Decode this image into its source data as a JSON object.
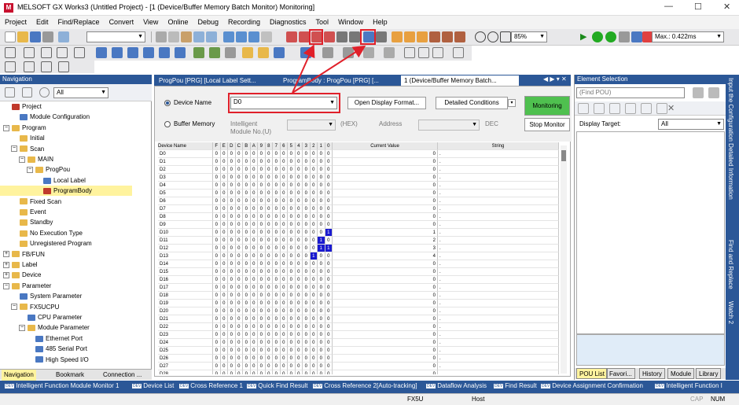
{
  "window": {
    "title": "MELSOFT GX Works3 (Untitled Project) - [1 (Device/Buffer Memory Batch Monitor) Monitoring]",
    "logo_text": "M",
    "minimize": "—",
    "maximize": "☐",
    "close": "✕"
  },
  "menu": [
    "Project",
    "Edit",
    "Find/Replace",
    "Convert",
    "View",
    "Online",
    "Debug",
    "Recording",
    "Diagnostics",
    "Tool",
    "Window",
    "Help"
  ],
  "toolbar": {
    "zoom": "85%",
    "scan_time": "Max.: 0.422ms"
  },
  "navigation": {
    "header": "Navigation",
    "filter": "All",
    "tree": [
      {
        "label": "Project",
        "depth": 0,
        "icon": "project",
        "expand": ""
      },
      {
        "label": "Module Configuration",
        "depth": 1,
        "icon": "module",
        "expand": ""
      },
      {
        "label": "Program",
        "depth": 0,
        "icon": "folder",
        "expand": "−"
      },
      {
        "label": "Initial",
        "depth": 1,
        "icon": "folder",
        "expand": ""
      },
      {
        "label": "Scan",
        "depth": 1,
        "icon": "folder",
        "expand": "−"
      },
      {
        "label": "MAIN",
        "depth": 2,
        "icon": "folder",
        "expand": "−"
      },
      {
        "label": "ProgPou",
        "depth": 3,
        "icon": "folder",
        "expand": "−"
      },
      {
        "label": "Local Label",
        "depth": 4,
        "icon": "label",
        "expand": ""
      },
      {
        "label": "ProgramBody",
        "depth": 4,
        "icon": "body",
        "expand": "",
        "selected": true
      },
      {
        "label": "Fixed Scan",
        "depth": 1,
        "icon": "folder",
        "expand": ""
      },
      {
        "label": "Event",
        "depth": 1,
        "icon": "folder",
        "expand": ""
      },
      {
        "label": "Standby",
        "depth": 1,
        "icon": "folder",
        "expand": ""
      },
      {
        "label": "No Execution Type",
        "depth": 1,
        "icon": "folder",
        "expand": ""
      },
      {
        "label": "Unregistered Program",
        "depth": 1,
        "icon": "folder",
        "expand": ""
      },
      {
        "label": "FB/FUN",
        "depth": 0,
        "icon": "folder",
        "expand": "+"
      },
      {
        "label": "Label",
        "depth": 0,
        "icon": "folder",
        "expand": "+"
      },
      {
        "label": "Device",
        "depth": 0,
        "icon": "folder",
        "expand": "+"
      },
      {
        "label": "Parameter",
        "depth": 0,
        "icon": "folder",
        "expand": "−"
      },
      {
        "label": "System Parameter",
        "depth": 1,
        "icon": "param",
        "expand": ""
      },
      {
        "label": "FX5UCPU",
        "depth": 1,
        "icon": "folder",
        "expand": "−"
      },
      {
        "label": "CPU Parameter",
        "depth": 2,
        "icon": "param",
        "expand": ""
      },
      {
        "label": "Module Parameter",
        "depth": 2,
        "icon": "folder",
        "expand": "−"
      },
      {
        "label": "Ethernet Port",
        "depth": 3,
        "icon": "param",
        "expand": ""
      },
      {
        "label": "485 Serial Port",
        "depth": 3,
        "icon": "param",
        "expand": ""
      },
      {
        "label": "High Speed I/O",
        "depth": 3,
        "icon": "param",
        "expand": ""
      }
    ],
    "tabs": [
      "Navigation",
      "Bookmark",
      "Connection ..."
    ]
  },
  "doc_tabs": [
    "ProgPou [PRG] [Local Label Sett...",
    "ProgramBody : ProgPou [PRG] [...",
    "1 (Device/Buffer Memory Batch..."
  ],
  "monitor": {
    "device_name_label": "Device Name",
    "device_value": "D0",
    "open_display_format": "Open Display Format...",
    "detailed_conditions": "Detailed Conditions",
    "monitoring_btn": "Monitoring",
    "stop_btn": "Stop Monitor",
    "buffer_memory_label": "Buffer Memory",
    "intelligent_label": "Intelligent",
    "module_no_label": "Module No.(U)",
    "hex_label": "(HEX)",
    "address_label": "Address",
    "dec_label": "DEC",
    "columns": [
      "Device Name",
      "F",
      "E",
      "D",
      "C",
      "B",
      "A",
      "9",
      "8",
      "7",
      "6",
      "5",
      "4",
      "3",
      "2",
      "1",
      "0",
      "Current Value",
      "String"
    ],
    "rows": [
      {
        "device": "D0",
        "value": "0",
        "string": "."
      },
      {
        "device": "D1",
        "value": "0",
        "string": "."
      },
      {
        "device": "D2",
        "value": "0",
        "string": "."
      },
      {
        "device": "D3",
        "value": "0",
        "string": "."
      },
      {
        "device": "D4",
        "value": "0",
        "string": "."
      },
      {
        "device": "D5",
        "value": "0",
        "string": "."
      },
      {
        "device": "D6",
        "value": "0",
        "string": "."
      },
      {
        "device": "D7",
        "value": "0",
        "string": "."
      },
      {
        "device": "D8",
        "value": "0",
        "string": "."
      },
      {
        "device": "D9",
        "value": "0",
        "string": "."
      },
      {
        "device": "D10",
        "value": "1",
        "string": "."
      },
      {
        "device": "D11",
        "value": "2",
        "string": "."
      },
      {
        "device": "D12",
        "value": "3",
        "string": "."
      },
      {
        "device": "D13",
        "value": "4",
        "string": "."
      },
      {
        "device": "D14",
        "value": "0",
        "string": "."
      },
      {
        "device": "D15",
        "value": "0",
        "string": "."
      },
      {
        "device": "D16",
        "value": "0",
        "string": "."
      },
      {
        "device": "D17",
        "value": "0",
        "string": "."
      },
      {
        "device": "D18",
        "value": "0",
        "string": "."
      },
      {
        "device": "D19",
        "value": "0",
        "string": "."
      },
      {
        "device": "D20",
        "value": "0",
        "string": "."
      },
      {
        "device": "D21",
        "value": "0",
        "string": "."
      },
      {
        "device": "D22",
        "value": "0",
        "string": "."
      },
      {
        "device": "D23",
        "value": "0",
        "string": "."
      },
      {
        "device": "D24",
        "value": "0",
        "string": "."
      },
      {
        "device": "D25",
        "value": "0",
        "string": "."
      },
      {
        "device": "D26",
        "value": "0",
        "string": "."
      },
      {
        "device": "D27",
        "value": "0",
        "string": "."
      },
      {
        "device": "D28",
        "value": "0",
        "string": "."
      }
    ]
  },
  "element_selection": {
    "header": "Element Selection",
    "find_placeholder": "(Find POU)",
    "display_target_label": "Display Target:",
    "display_target_value": "All",
    "tabs": [
      "POU List",
      "Favori...",
      "History",
      "Module",
      "Library"
    ]
  },
  "right_side_tabs": [
    "Input the Configuration Detailed Information",
    "Find and Replace",
    "Watch 2"
  ],
  "bottom_tabs": [
    "Intelligent Function Module Monitor 1",
    "Device List",
    "Cross Reference 1",
    "Quick Find Result",
    "Cross Reference 2[Auto-tracking]",
    "Dataflow Analysis",
    "Find Result",
    "Device Assignment Confirmation",
    "Intelligent Function I"
  ],
  "bottom_tab_tag": "DEV",
  "status": {
    "cpu": "FX5U",
    "connection": "Host",
    "caps": "CAP",
    "num": "NUM"
  },
  "colors": {
    "accent": "#2b5797",
    "highlight_box": "#e0202a",
    "bit_on": "#1a1ad0",
    "selected_node": "#fff39e"
  }
}
